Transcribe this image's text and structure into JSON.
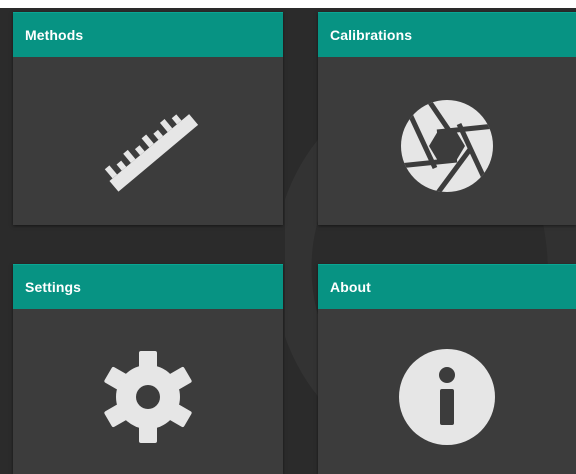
{
  "tiles": {
    "methods": {
      "label": "Methods",
      "icon": "ruler-icon"
    },
    "calibrations": {
      "label": "Calibrations",
      "icon": "aperture-icon"
    },
    "settings": {
      "label": "Settings",
      "icon": "gear-icon"
    },
    "about": {
      "label": "About",
      "icon": "info-icon"
    }
  },
  "colors": {
    "header": "#079383",
    "tile_body": "#3c3c3c",
    "background": "#2b2b2b",
    "icon": "#e6e6e6"
  }
}
